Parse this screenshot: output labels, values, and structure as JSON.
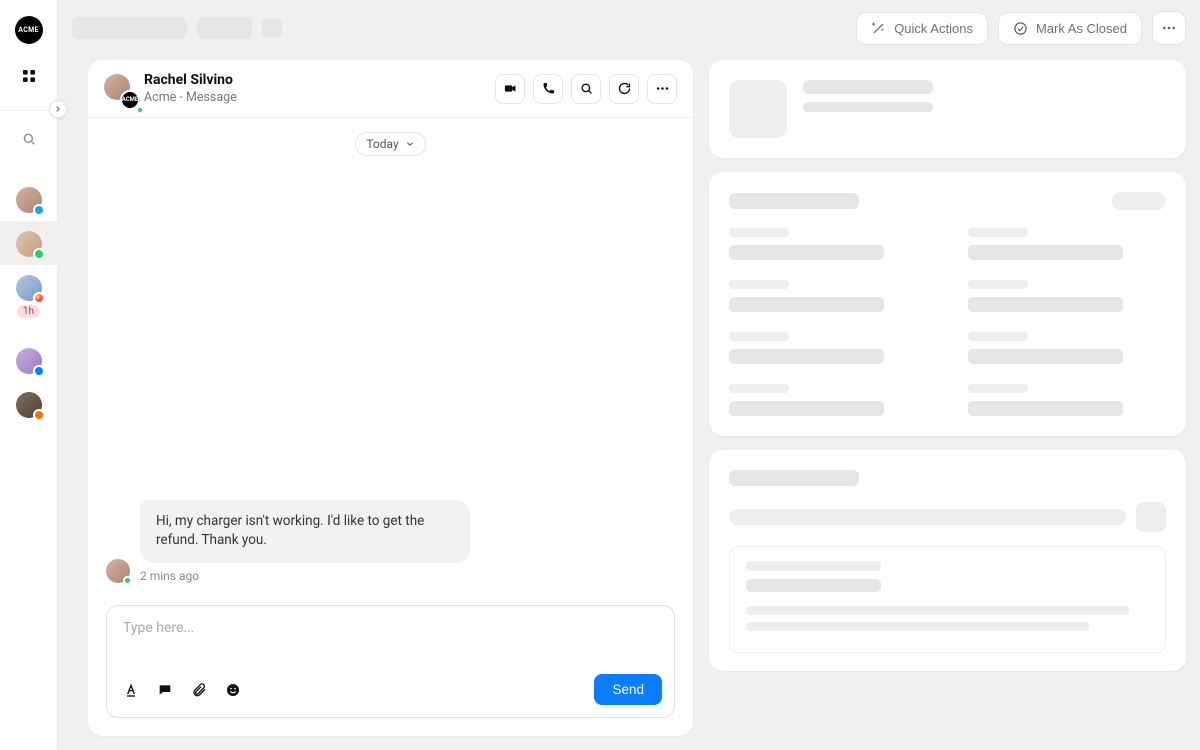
{
  "brand": {
    "logo_text": "ACME"
  },
  "rail": {
    "conversations": [
      {
        "channel": "twitter",
        "time_badge": null
      },
      {
        "channel": "whatsapp",
        "time_badge": null,
        "selected": true
      },
      {
        "channel": "instagram",
        "time_badge": "1h"
      },
      {
        "channel": "messenger",
        "time_badge": null
      },
      {
        "channel": "orange",
        "time_badge": null
      }
    ]
  },
  "topbar": {
    "quick_actions_label": "Quick Actions",
    "mark_closed_label": "Mark As Closed"
  },
  "chat": {
    "contact_name": "Rachel Silvino",
    "subtitle": "Acme - Message",
    "org_badge": "ACME",
    "date_label": "Today",
    "messages": [
      {
        "text": "Hi, my charger isn't working. I'd like to get the refund. Thank you.",
        "time": "2 mins ago",
        "channel": "whatsapp"
      }
    ],
    "composer_placeholder": "Type here...",
    "send_label": "Send"
  }
}
